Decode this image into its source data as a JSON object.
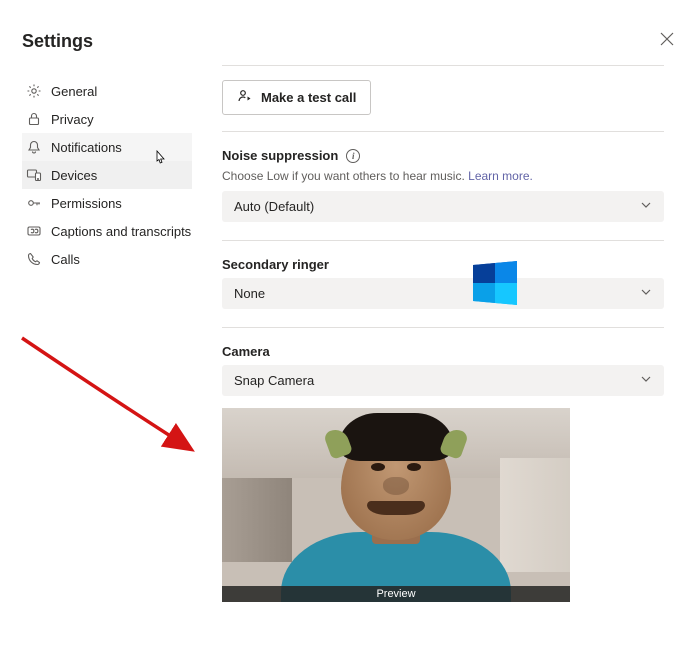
{
  "header": {
    "title": "Settings"
  },
  "sidebar": {
    "items": [
      {
        "label": "General"
      },
      {
        "label": "Privacy"
      },
      {
        "label": "Notifications"
      },
      {
        "label": "Devices"
      },
      {
        "label": "Permissions"
      },
      {
        "label": "Captions and transcripts"
      },
      {
        "label": "Calls"
      }
    ]
  },
  "testCall": {
    "label": "Make a test call"
  },
  "noise": {
    "title": "Noise suppression",
    "helper": "Choose Low if you want others to hear music.",
    "learn_more": "Learn more.",
    "selected": "Auto (Default)"
  },
  "ringer": {
    "title": "Secondary ringer",
    "selected": "None"
  },
  "camera": {
    "title": "Camera",
    "selected": "Snap Camera",
    "preview_label": "Preview"
  }
}
